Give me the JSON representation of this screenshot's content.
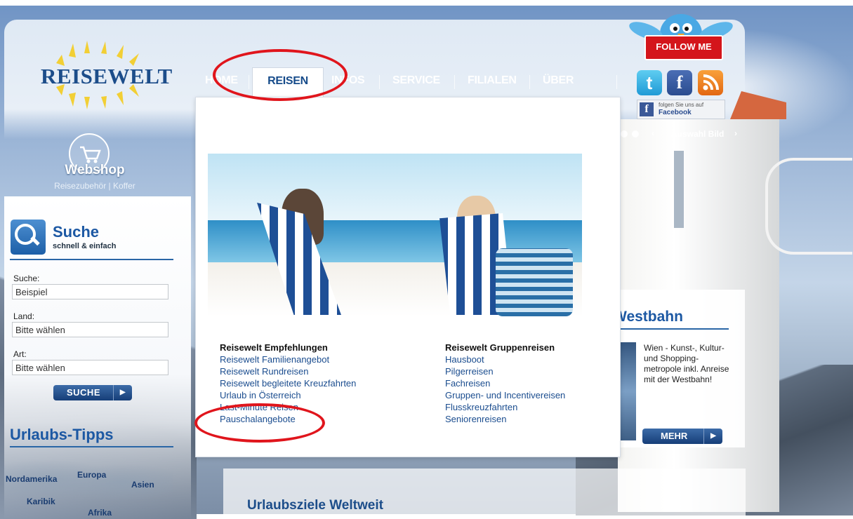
{
  "logo": {
    "text": "REISEWELT"
  },
  "nav": {
    "items": [
      {
        "label": "HOME"
      },
      {
        "label": "REISEN"
      },
      {
        "label": "INFOS"
      },
      {
        "label": "SERVICE"
      },
      {
        "label": "FILIALEN"
      },
      {
        "label": "ÜBER UNS"
      }
    ],
    "active": "REISEN"
  },
  "social": {
    "follow_label": "FOLLOW ME",
    "twitter_glyph": "t",
    "facebook_glyph": "f",
    "facebook_badge_small": "folgen Sie uns auf",
    "facebook_badge_big": "Facebook"
  },
  "slider": {
    "label": "Auswahl Bild"
  },
  "webshop": {
    "title": "Webshop",
    "subtitle": "Reisezubehör | Koffer"
  },
  "search": {
    "title": "Suche",
    "subtitle": "schnell & einfach",
    "fields": [
      {
        "label": "Suche:",
        "value": "Beispiel"
      },
      {
        "label": "Land:",
        "value": "Bitte wählen"
      },
      {
        "label": "Art:",
        "value": "Bitte wählen"
      }
    ],
    "button_label": "SUCHE"
  },
  "tips": {
    "title": "Urlaubs-Tipps",
    "regions": [
      "Nordamerika",
      "Europa",
      "Asien",
      "Karibik",
      "Afrika"
    ]
  },
  "dropdown": {
    "left_title": "Reisewelt Empfehlungen",
    "left_links": [
      "Reisewelt Familienangebot",
      "Reisewelt Rundreisen",
      "Reisewelt begleitete Kreuzfahrten",
      "Urlaub in Österreich",
      "Last-Minute Reisen",
      "Pauschalangebote"
    ],
    "right_title": "Reisewelt Gruppenreisen",
    "right_links": [
      "Hausboot",
      "Pilgerreisen",
      "Fachreisen",
      "Gruppen- und Incentivereisen",
      "Flusskreuzfahrten",
      "Seniorenreisen"
    ]
  },
  "westbahn": {
    "title": "Westbahn",
    "text": "Wien - Kunst-, Kultur- und Shopping-metropole inkl. Anreise mit der Westbahn!",
    "button_label": "MEHR"
  },
  "bottom": {
    "title": "Urlaubsziele Weltweit"
  },
  "colors": {
    "brand_blue": "#1c58a3",
    "annotation_red": "#e0151c",
    "link_blue": "#1b4d8f"
  }
}
